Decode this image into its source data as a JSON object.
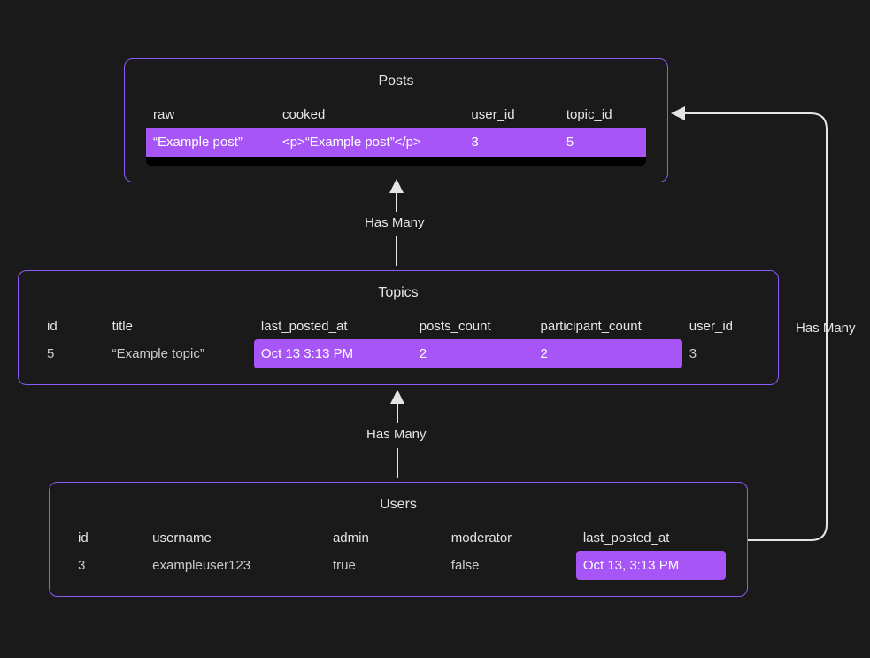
{
  "relationships": {
    "topics_to_posts": "Has Many",
    "users_to_topics": "Has Many",
    "users_to_posts": "Has Many"
  },
  "posts": {
    "title": "Posts",
    "columns": {
      "raw": "raw",
      "cooked": "cooked",
      "user_id": "user_id",
      "topic_id": "topic_id"
    },
    "row": {
      "raw": "“Example post”",
      "cooked": "<p>“Example post”</p>",
      "user_id": "3",
      "topic_id": "5"
    }
  },
  "topics": {
    "title": "Topics",
    "columns": {
      "id": "id",
      "title": "title",
      "last_posted_at": "last_posted_at",
      "posts_count": "posts_count",
      "participant_count": "participant_count",
      "user_id": "user_id"
    },
    "row": {
      "id": "5",
      "title": "“Example topic”",
      "last_posted_at": "Oct 13 3:13 PM",
      "posts_count": "2",
      "participant_count": "2",
      "user_id": "3"
    }
  },
  "users": {
    "title": "Users",
    "columns": {
      "id": "id",
      "username": "username",
      "admin": "admin",
      "moderator": "moderator",
      "last_posted_at": "last_posted_at"
    },
    "row": {
      "id": "3",
      "username": "exampleuser123",
      "admin": "true",
      "moderator": "false",
      "last_posted_at": "Oct 13, 3:13 PM"
    }
  }
}
